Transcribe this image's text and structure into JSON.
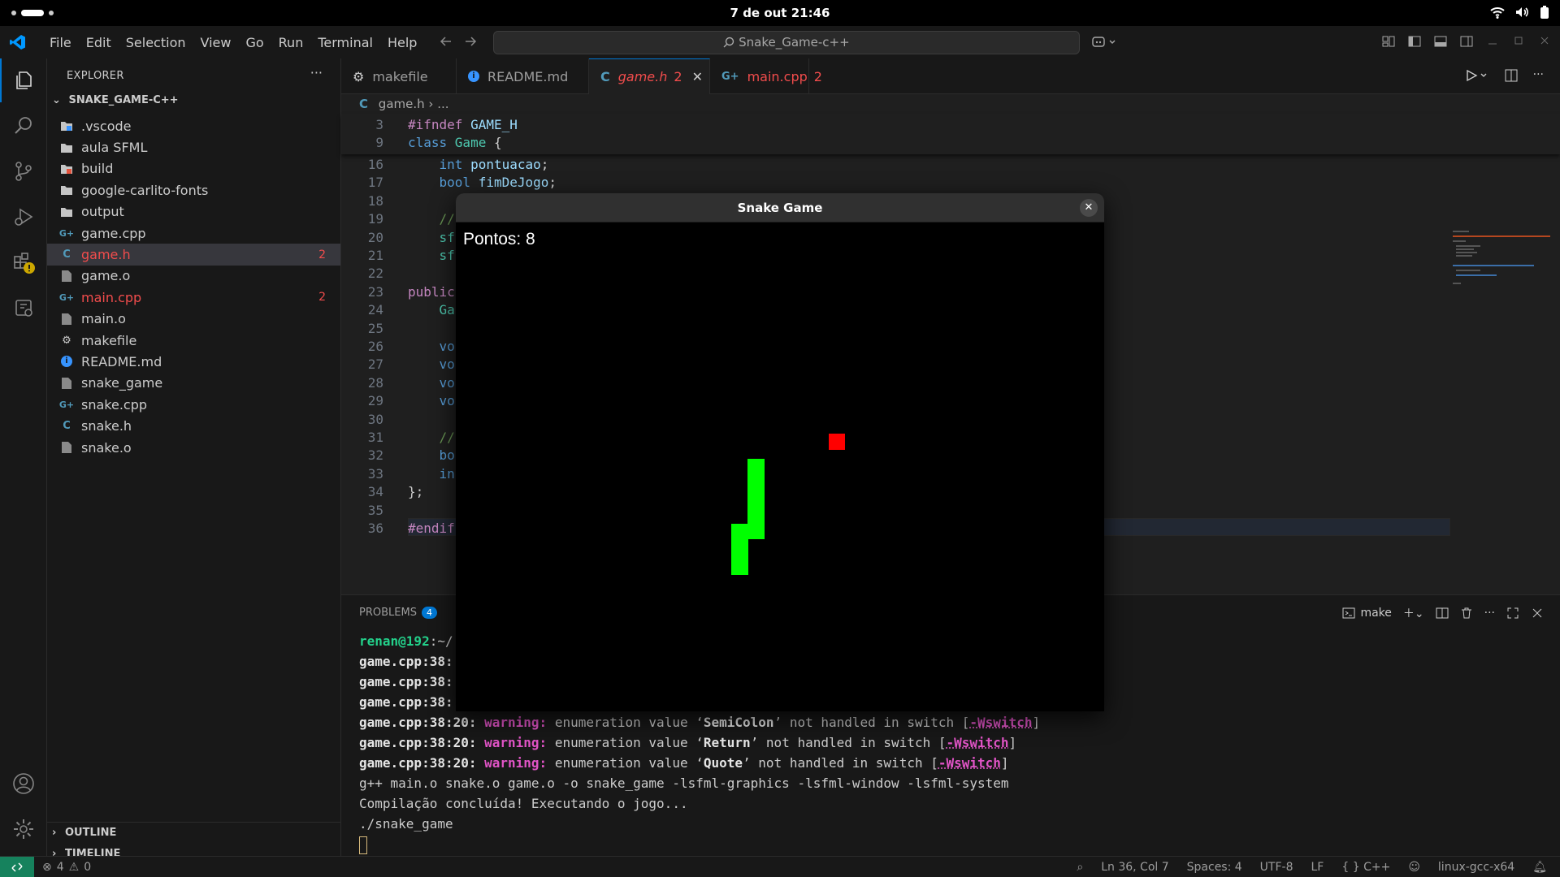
{
  "topbar": {
    "datetime": "7 de out  21:46"
  },
  "titlebar": {
    "menu": [
      "File",
      "Edit",
      "Selection",
      "View",
      "Go",
      "Run",
      "Terminal",
      "Help"
    ],
    "search": "Snake_Game-c++"
  },
  "explorer": {
    "header": "EXPLORER",
    "root": "SNAKE_GAME-C++",
    "files": [
      {
        "name": ".vscode",
        "icon": "vscode-folder-icon",
        "badge": ""
      },
      {
        "name": "aula SFML",
        "icon": "folder-icon",
        "badge": ""
      },
      {
        "name": "build",
        "icon": "build-folder-icon",
        "badge": ""
      },
      {
        "name": "google-carlito-fonts",
        "icon": "folder-icon",
        "badge": ""
      },
      {
        "name": "output",
        "icon": "folder-icon",
        "badge": ""
      },
      {
        "name": "game.cpp",
        "icon": "cpp-file-icon",
        "badge": ""
      },
      {
        "name": "game.h",
        "icon": "c-header-icon",
        "badge": "2"
      },
      {
        "name": "game.o",
        "icon": "file-icon",
        "badge": ""
      },
      {
        "name": "main.cpp",
        "icon": "cpp-file-icon",
        "badge": "2"
      },
      {
        "name": "main.o",
        "icon": "file-icon",
        "badge": ""
      },
      {
        "name": "makefile",
        "icon": "makefile-icon",
        "badge": ""
      },
      {
        "name": "README.md",
        "icon": "info-icon",
        "badge": ""
      },
      {
        "name": "snake_game",
        "icon": "file-icon",
        "badge": ""
      },
      {
        "name": "snake.cpp",
        "icon": "cpp-file-icon",
        "badge": ""
      },
      {
        "name": "snake.h",
        "icon": "c-header-icon",
        "badge": ""
      },
      {
        "name": "snake.o",
        "icon": "file-icon",
        "badge": ""
      }
    ],
    "outline": "OUTLINE",
    "timeline": "TIMELINE"
  },
  "tabs": [
    {
      "label": "makefile",
      "count": ""
    },
    {
      "label": "README.md",
      "count": ""
    },
    {
      "label": "game.h",
      "count": "2"
    },
    {
      "label": "main.cpp",
      "count": "2"
    }
  ],
  "breadcrumb": {
    "file": "game.h",
    "rest": "..."
  },
  "editor": {
    "sticky": [
      {
        "n": "3",
        "segs": [
          [
            "pp",
            "#ifndef "
          ],
          [
            "id",
            "GAME_H"
          ]
        ]
      },
      {
        "n": "9",
        "segs": [
          [
            "ty",
            "class "
          ],
          [
            "cls",
            "Game "
          ],
          [
            "pun",
            "{"
          ]
        ]
      }
    ],
    "lines": [
      {
        "n": "16",
        "segs": [
          [
            "ty",
            "    int "
          ],
          [
            "id",
            "pontuacao"
          ],
          [
            "pun",
            ";"
          ]
        ]
      },
      {
        "n": "17",
        "segs": [
          [
            "ty",
            "    bool "
          ],
          [
            "id",
            "fimDeJogo"
          ],
          [
            "pun",
            ";"
          ]
        ]
      },
      {
        "n": "18",
        "segs": []
      },
      {
        "n": "19",
        "segs": [
          [
            "cm",
            "    //"
          ]
        ]
      },
      {
        "n": "20",
        "segs": [
          [
            "cls",
            "    sf"
          ]
        ]
      },
      {
        "n": "21",
        "segs": [
          [
            "cls",
            "    sf"
          ]
        ]
      },
      {
        "n": "22",
        "segs": []
      },
      {
        "n": "23",
        "segs": [
          [
            "kw",
            "public"
          ]
        ]
      },
      {
        "n": "24",
        "segs": [
          [
            "cls",
            "    Ga"
          ]
        ]
      },
      {
        "n": "25",
        "segs": []
      },
      {
        "n": "26",
        "segs": [
          [
            "ty",
            "    vo"
          ]
        ]
      },
      {
        "n": "27",
        "segs": [
          [
            "ty",
            "    vo"
          ]
        ]
      },
      {
        "n": "28",
        "segs": [
          [
            "ty",
            "    vo"
          ]
        ]
      },
      {
        "n": "29",
        "segs": [
          [
            "ty",
            "    vo"
          ]
        ]
      },
      {
        "n": "30",
        "segs": []
      },
      {
        "n": "31",
        "segs": [
          [
            "cm",
            "    //"
          ]
        ]
      },
      {
        "n": "32",
        "segs": [
          [
            "ty",
            "    bo"
          ]
        ]
      },
      {
        "n": "33",
        "segs": [
          [
            "ty",
            "    in"
          ]
        ]
      },
      {
        "n": "34",
        "segs": [
          [
            "pun",
            "};"
          ]
        ]
      },
      {
        "n": "35",
        "segs": []
      },
      {
        "n": "36",
        "segs": [
          [
            "pp",
            "#endif"
          ]
        ]
      }
    ]
  },
  "panel": {
    "tab": "PROBLEMS",
    "count": "4",
    "terminal_name": "make",
    "terminal": [
      [
        [
          "g",
          "renan@192"
        ],
        [
          "n",
          ":~/"
        ]
      ],
      [
        [
          "b",
          "game.cpp:38:"
        ]
      ],
      [
        [
          "b",
          "game.cpp:38:"
        ]
      ],
      [
        [
          "b",
          "game.cpp:38:"
        ]
      ],
      [
        [
          "b",
          "game.cpp:38:20: "
        ],
        [
          "w",
          "warning: "
        ],
        [
          "n",
          "enumeration value ‘"
        ],
        [
          "b",
          "SemiColon"
        ],
        [
          "n",
          "’ not handled in switch ["
        ],
        [
          "u",
          "-Wswitch"
        ],
        [
          "n",
          "]"
        ]
      ],
      [
        [
          "b",
          "game.cpp:38:20: "
        ],
        [
          "w",
          "warning: "
        ],
        [
          "n",
          "enumeration value ‘"
        ],
        [
          "b",
          "Return"
        ],
        [
          "n",
          "’ not handled in switch ["
        ],
        [
          "u",
          "-Wswitch"
        ],
        [
          "n",
          "]"
        ]
      ],
      [
        [
          "b",
          "game.cpp:38:20: "
        ],
        [
          "w",
          "warning: "
        ],
        [
          "n",
          "enumeration value ‘"
        ],
        [
          "b",
          "Quote"
        ],
        [
          "n",
          "’ not handled in switch ["
        ],
        [
          "u",
          "-Wswitch"
        ],
        [
          "n",
          "]"
        ]
      ],
      [
        [
          "n",
          "g++ main.o snake.o game.o -o snake_game -lsfml-graphics -lsfml-window -lsfml-system"
        ]
      ],
      [
        [
          "n",
          "Compilação concluída! Executando o jogo..."
        ]
      ],
      [
        [
          "n",
          "./snake_game"
        ]
      ]
    ]
  },
  "status": {
    "errors": "4",
    "warnings": "0",
    "position": "Ln 36, Col 7",
    "spaces": "Spaces: 4",
    "encoding": "UTF-8",
    "eol": "LF",
    "language": "C++",
    "config": "linux-gcc-x64"
  },
  "game": {
    "title": "Snake Game",
    "score_text": "Pontos: 8",
    "snake_color": "#00ff00",
    "food_color": "#ff0000"
  }
}
